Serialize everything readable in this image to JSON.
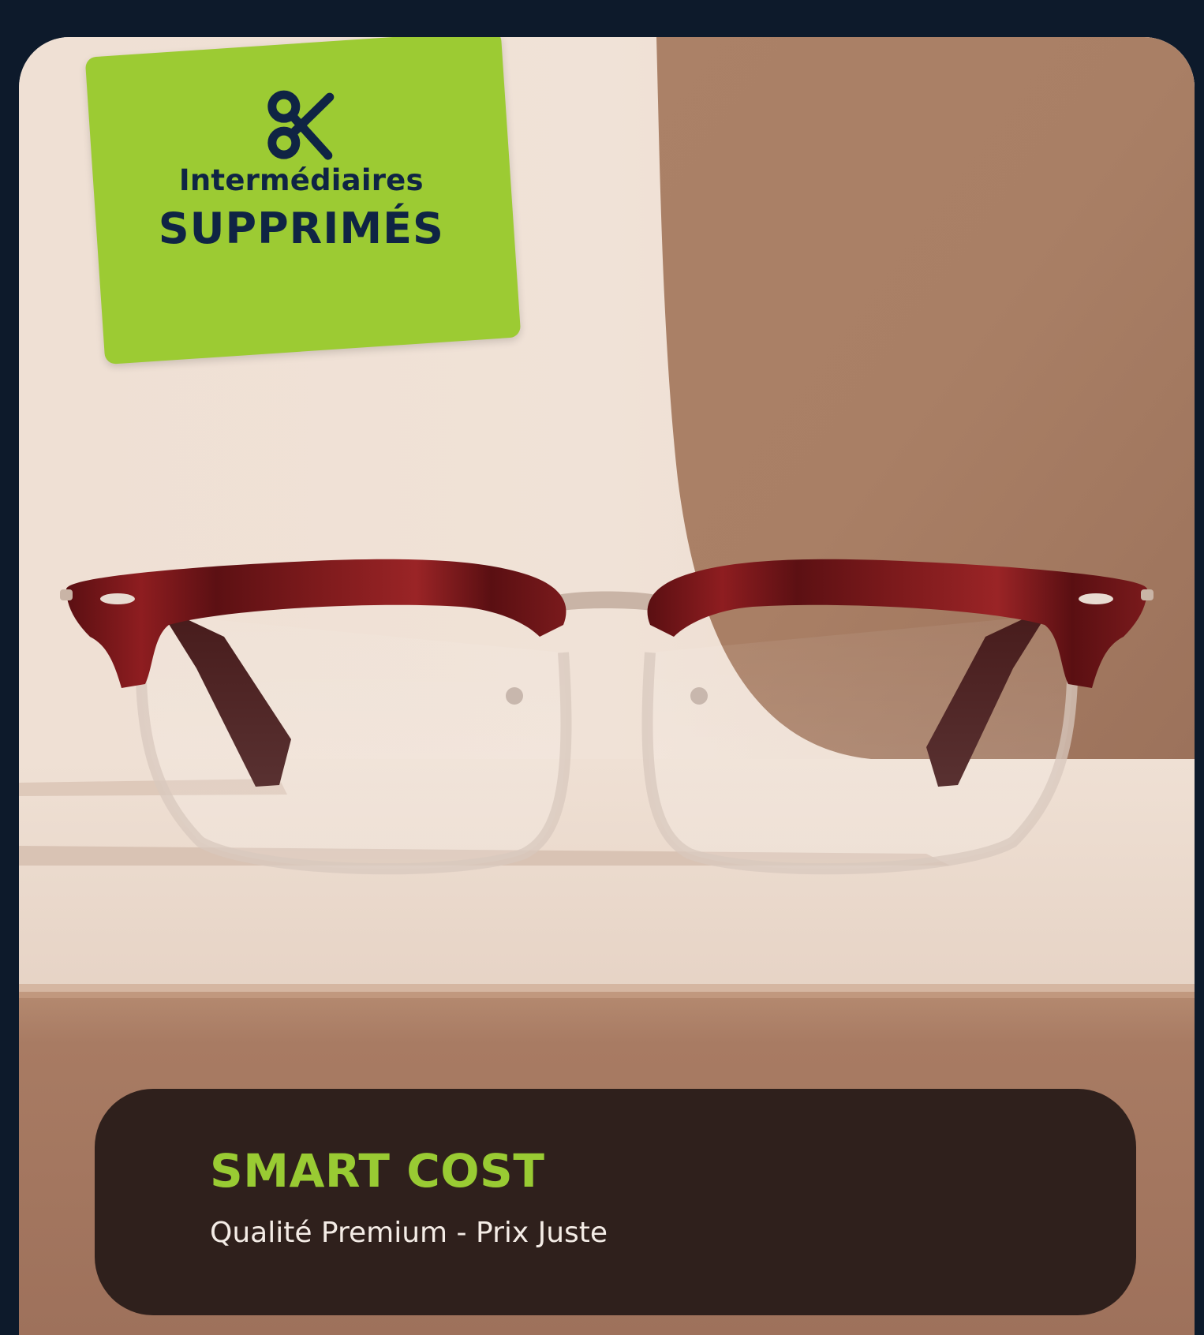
{
  "badge": {
    "icon": "scissors-icon",
    "line1": "Intermédiaires",
    "line2": "SUPPRIMÉS",
    "background_color": "#9ccb33",
    "text_color": "#0f2444"
  },
  "hero_image": {
    "subject": "eyeglasses-image"
  },
  "caption": {
    "title": "SMART COST",
    "subtitle": "Qualité Premium - Prix Juste",
    "title_color": "#99cb33",
    "background_color": "#2f201c"
  },
  "colors": {
    "page_background": "#0d1a2b"
  }
}
